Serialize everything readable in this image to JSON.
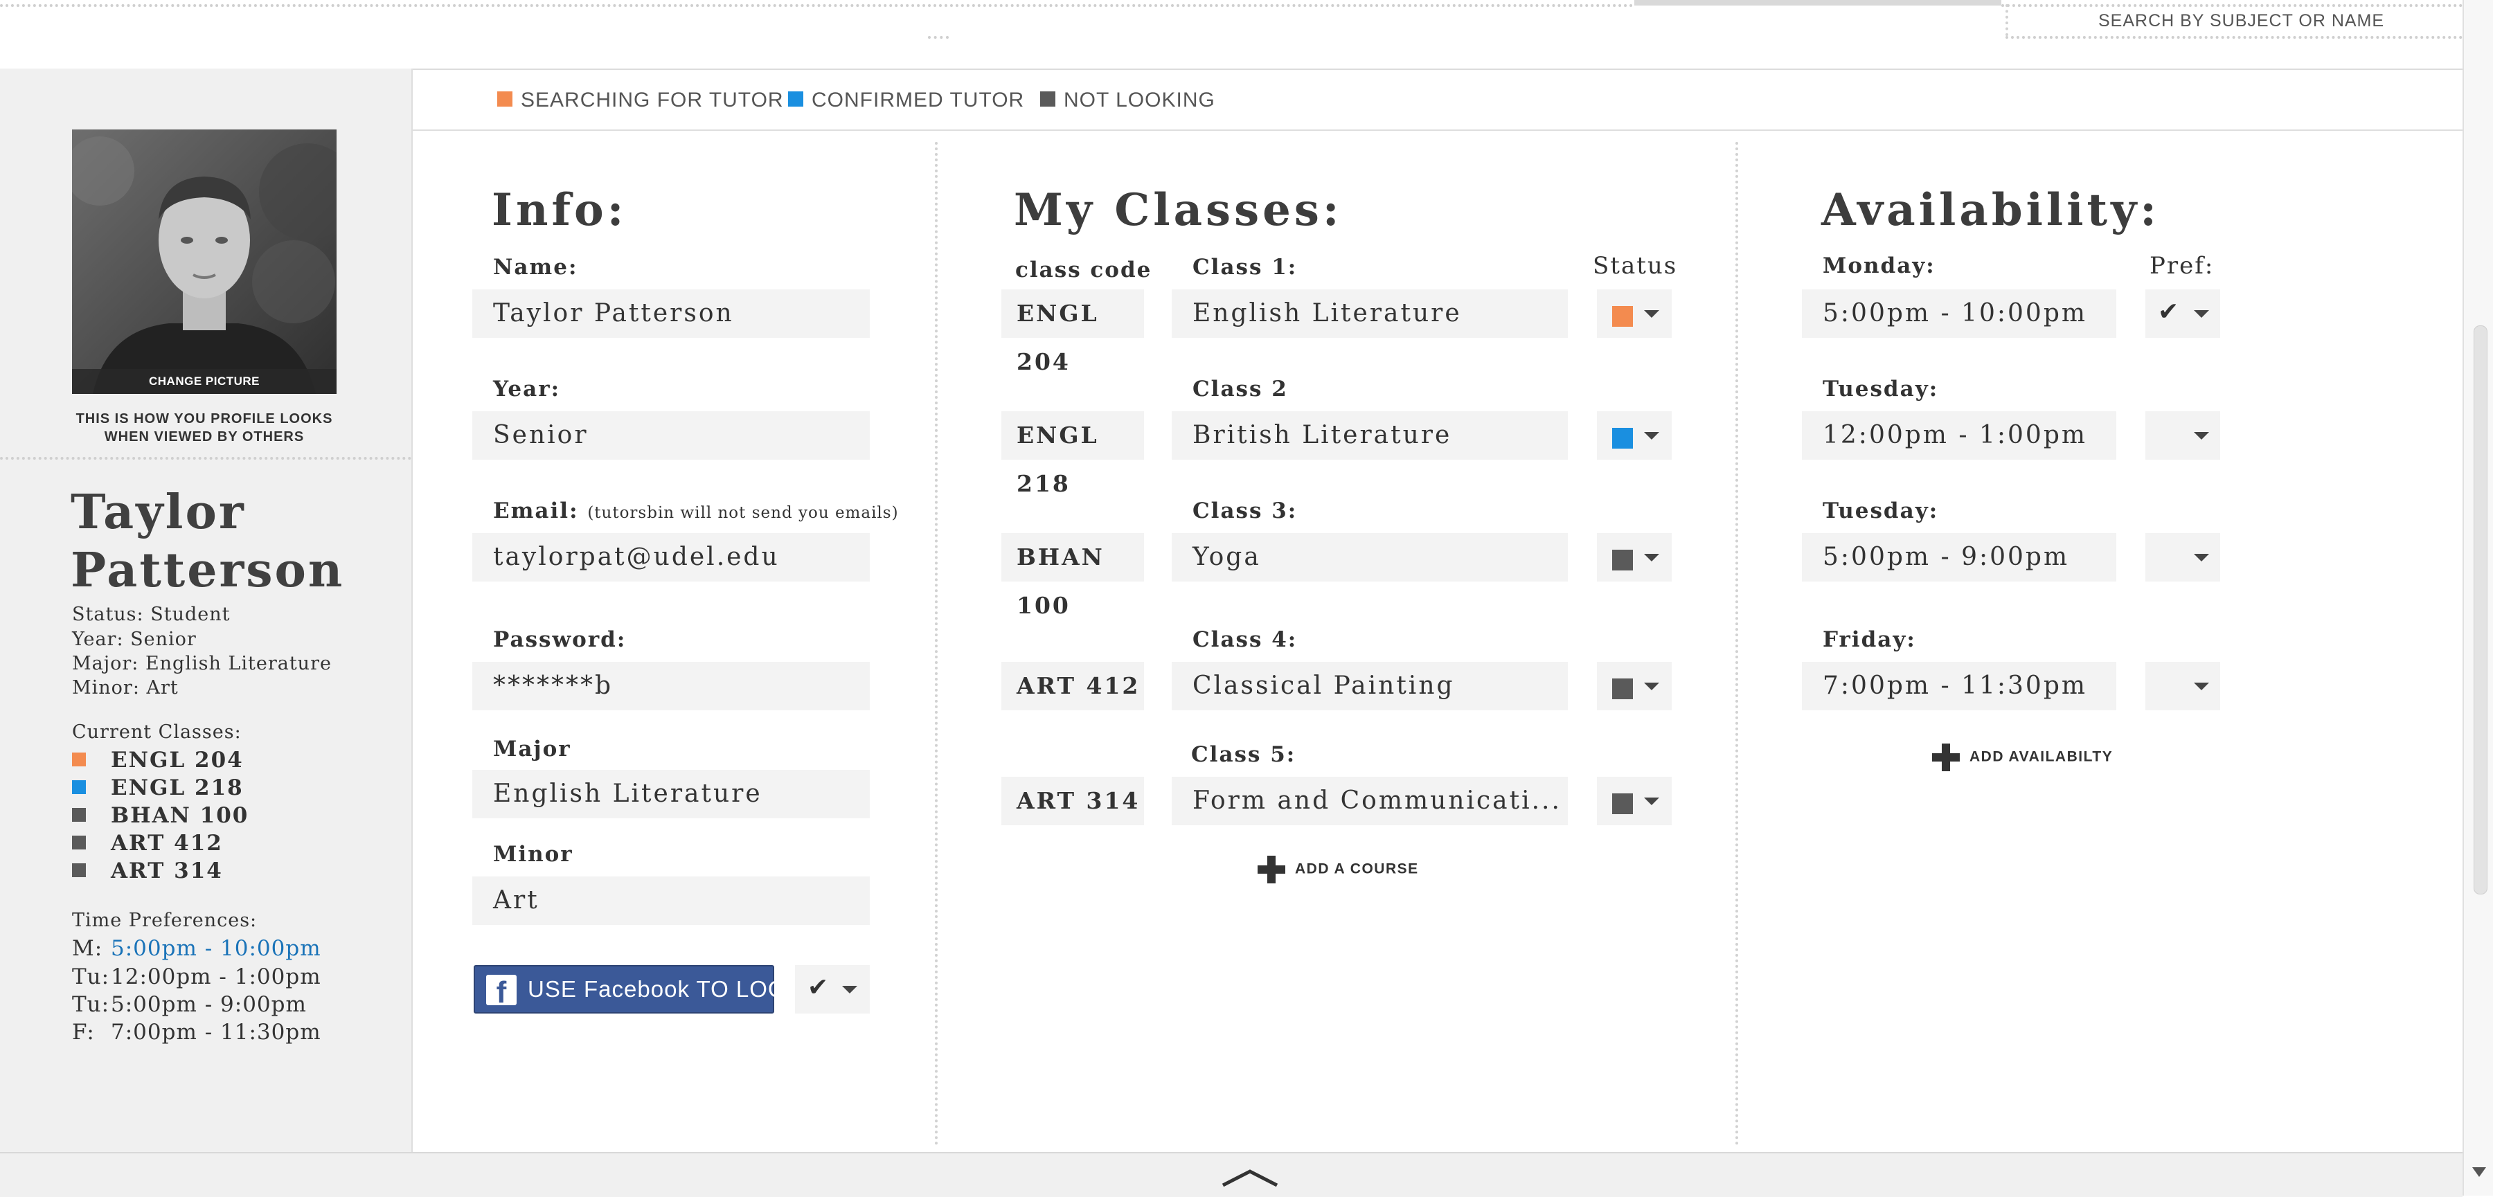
{
  "header": {
    "search_label": "SEARCH BY SUBJECT OR NAME"
  },
  "legend": [
    {
      "label": "SEARCHING FOR TUTOR",
      "color": "#f38b4f"
    },
    {
      "label": "CONFIRMED TUTOR",
      "color": "#1a8fe0"
    },
    {
      "label": "NOT LOOKING",
      "color": "#5a5a5a"
    }
  ],
  "sidebar": {
    "change_picture": "CHANGE PICTURE",
    "note_line1": "THIS IS HOW YOU PROFILE LOOKS",
    "note_line2": "WHEN VIEWED BY OTHERS",
    "name_first": "Taylor",
    "name_last": "Patterson",
    "status": "Status: Student",
    "year": "Year: Senior",
    "major": "Major: English Literature",
    "minor": "Minor: Art",
    "current_classes_label": "Current Classes:",
    "classes": [
      {
        "code": "ENGL 204",
        "color": "#f38b4f"
      },
      {
        "code": "ENGL 218",
        "color": "#1a8fe0"
      },
      {
        "code": "BHAN 100",
        "color": "#5a5a5a"
      },
      {
        "code": "ART 412",
        "color": "#5a5a5a"
      },
      {
        "code": "ART 314",
        "color": "#5a5a5a"
      }
    ],
    "time_pref_label": "Time Preferences:",
    "time_prefs": [
      {
        "day": "M:",
        "time": "5:00pm - 10:00pm",
        "highlight": true
      },
      {
        "day": "Tu:",
        "time": "12:00pm - 1:00pm",
        "highlight": false
      },
      {
        "day": "Tu:",
        "time": "5:00pm - 9:00pm",
        "highlight": false
      },
      {
        "day": "F:",
        "time": "7:00pm - 11:30pm",
        "highlight": false
      }
    ],
    "highlight_color": "#1a73b8"
  },
  "info": {
    "heading": "Info:",
    "name_label": "Name:",
    "name_value": "Taylor Patterson",
    "year_label": "Year:",
    "year_value": "Senior",
    "email_label": "Email:",
    "email_note": "(tutorsbin will not send you emails)",
    "email_value": "taylorpat@udel.edu",
    "password_label": "Password:",
    "password_value": "*******b",
    "major_label": "Major",
    "major_value": "English Literature",
    "minor_label": "Minor",
    "minor_value": "Art",
    "facebook_label": "USE Facebook TO LOGIN",
    "facebook_letter": "f",
    "facebook_color": "#3b5998"
  },
  "classes": {
    "heading": "My Classes:",
    "code_header": "class code",
    "status_header": "Status",
    "rows": [
      {
        "label": "Class 1:",
        "code": "ENGL 204",
        "name": "English Literature",
        "status_color": "#f38b4f"
      },
      {
        "label": "Class 2",
        "code": "ENGL 218",
        "name": "British Literature",
        "status_color": "#1a8fe0"
      },
      {
        "label": "Class 3:",
        "code": "BHAN 100",
        "name": "Yoga",
        "status_color": "#5a5a5a"
      },
      {
        "label": "Class 4:",
        "code": "ART 412",
        "name": "Classical Painting",
        "status_color": "#5a5a5a"
      },
      {
        "label": "Class 5:",
        "code": "ART 314",
        "name": "Form and Communicati...",
        "status_color": "#5a5a5a"
      }
    ],
    "add_label": "ADD A COURSE"
  },
  "availability": {
    "heading": "Availability:",
    "pref_header": "Pref:",
    "rows": [
      {
        "day": "Monday:",
        "time": "5:00pm - 10:00pm",
        "preferred": true
      },
      {
        "day": "Tuesday:",
        "time": "12:00pm - 1:00pm",
        "preferred": false
      },
      {
        "day": "Tuesday:",
        "time": "5:00pm - 9:00pm",
        "preferred": false
      },
      {
        "day": "Friday:",
        "time": "7:00pm - 11:30pm",
        "preferred": false
      }
    ],
    "add_label": "ADD AVAILABILTY"
  }
}
